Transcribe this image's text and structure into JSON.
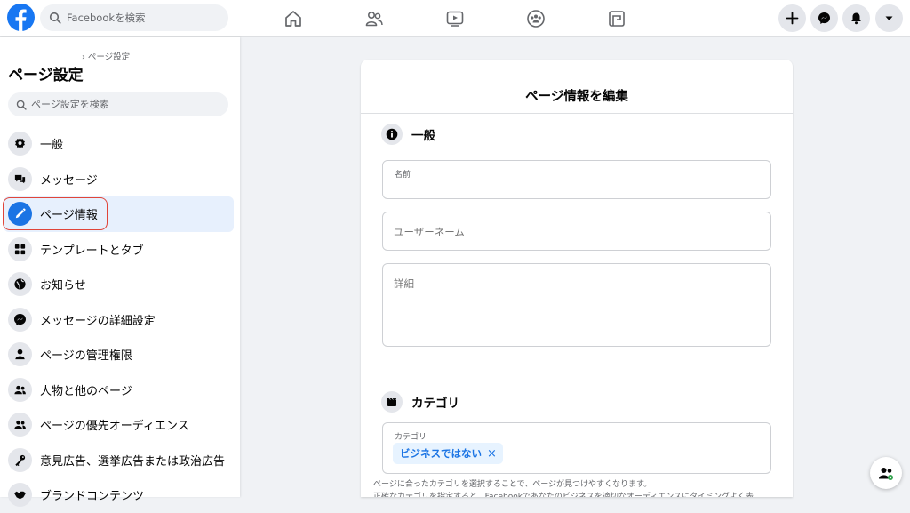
{
  "app": {
    "brand_color": "#1877f2",
    "accent_color": "#1b74e4",
    "highlight_color": "#e0453a"
  },
  "topbar": {
    "logo_icon": "facebook-logo",
    "search_placeholder": "Facebookを検索",
    "nav_icons": [
      "home-icon",
      "friends-icon",
      "watch-icon",
      "groups-icon",
      "gaming-icon"
    ],
    "right_buttons": [
      "plus-icon",
      "messenger-icon",
      "notifications-icon",
      "account-dropdown-icon"
    ]
  },
  "sidebar": {
    "breadcrumb": "› ページ設定",
    "title": "ページ設定",
    "search_placeholder": "ページ設定を検索",
    "items": [
      {
        "label": "一般",
        "icon": "gear-icon",
        "active": false
      },
      {
        "label": "メッセージ",
        "icon": "chat-bubbles-icon",
        "active": false
      },
      {
        "label": "ページ情報",
        "icon": "pencil-icon",
        "active": true
      },
      {
        "label": "テンプレートとタブ",
        "icon": "grid-icon",
        "active": false
      },
      {
        "label": "お知らせ",
        "icon": "globe-icon",
        "active": false
      },
      {
        "label": "メッセージの詳細設定",
        "icon": "messenger-icon",
        "active": false
      },
      {
        "label": "ページの管理権限",
        "icon": "person-icon",
        "active": false
      },
      {
        "label": "人物と他のページ",
        "icon": "people-icon",
        "active": false
      },
      {
        "label": "ページの優先オーディエンス",
        "icon": "people-icon",
        "active": false
      },
      {
        "label": "意見広告、選挙広告または政治広告",
        "icon": "key-icon",
        "active": false
      },
      {
        "label": "ブランドコンテンツ",
        "icon": "handshake-icon",
        "active": false
      }
    ]
  },
  "editor": {
    "title": "ページ情報を編集",
    "general": {
      "heading": "一般",
      "icon": "info-icon",
      "name_label": "名前",
      "name_value": "",
      "username_placeholder": "ユーザーネーム",
      "details_placeholder": "詳細"
    },
    "category": {
      "heading": "カテゴリ",
      "icon": "clapperboard-icon",
      "field_label": "カテゴリ",
      "chip_label": "ビジネスではない",
      "chip_remove": "×",
      "help_line1": "ページに合ったカテゴリを選択することで、ページが見つけやすくなります。",
      "help_line2": "正確なカテゴリを指定すると、Facebookであなたのビジネスを適切なオーディエンスにタイミングよく表"
    }
  },
  "floating_button": {
    "icon": "people-badge-icon"
  }
}
